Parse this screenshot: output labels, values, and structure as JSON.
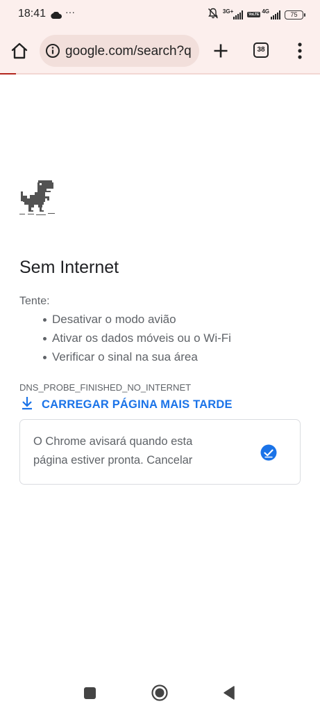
{
  "status_bar": {
    "time": "18:41",
    "dots": "···",
    "network_1": "3G+",
    "network_2": "4G",
    "volte": "VoLTE",
    "battery": "75"
  },
  "toolbar": {
    "url": "google.com/search?q",
    "tab_count": "38",
    "page_load_progress": 0.05
  },
  "page": {
    "title": "Sem Internet",
    "try_label": "Tente:",
    "suggestions": [
      "Desativar o modo avião",
      "Ativar os dados móveis ou o Wi-Fi",
      "Verificar o sinal na sua área"
    ],
    "error_code": "DNS_PROBE_FINISHED_NO_INTERNET",
    "reload_label": "CARREGAR PÁGINA MAIS TARDE",
    "notify_line_1": "O Chrome avisará quando esta",
    "notify_line_2": "página estiver pronta. Cancelar",
    "notify_checked": true
  },
  "icons": {
    "home": "home-icon",
    "info": "info-icon",
    "new_tab": "plus-icon",
    "tabs": "tab-switcher-icon",
    "menu": "more-vert-icon",
    "dino": "dinosaur-icon",
    "download": "download-icon",
    "check": "check-circle-icon",
    "mute": "bell-off-icon",
    "cloud": "cloud-icon"
  },
  "colors": {
    "toolbar_bg": "#fcefed",
    "omnibox_bg": "#f2dfdb",
    "link_blue": "#1a73e8",
    "progress": "#b3261e",
    "text_primary": "#202124",
    "text_secondary": "#5f6368"
  }
}
